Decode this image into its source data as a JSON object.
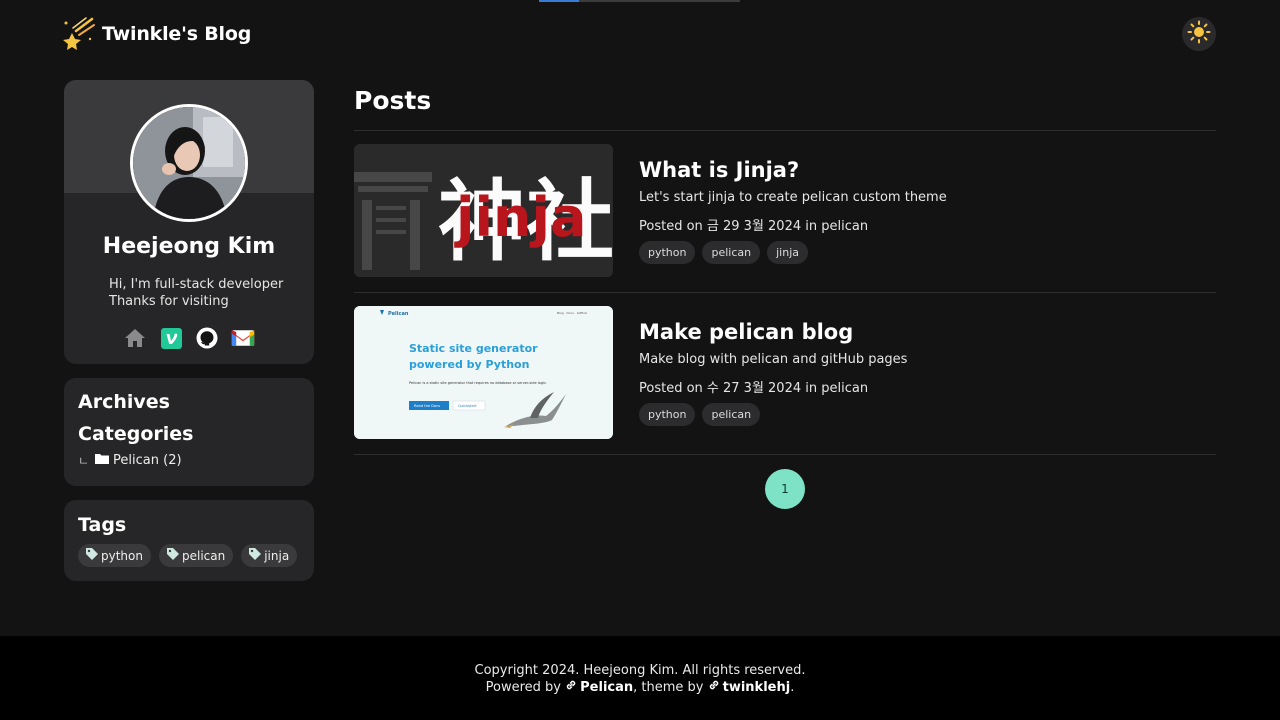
{
  "header": {
    "site_title": "Twinkle's Blog",
    "reading_progress_pct": 20
  },
  "profile": {
    "name": "Heejeong Kim",
    "bio_line1": "Hi, I'm full-stack developer",
    "bio_line2": "Thanks for visiting",
    "social_icons": [
      "home-icon",
      "velog-icon",
      "github-icon",
      "gmail-icon"
    ]
  },
  "archives": {
    "archives_title": "Archives",
    "categories_title": "Categories",
    "category": {
      "branch": "ㄴ",
      "label": "Pelican (2)"
    }
  },
  "tags": {
    "title": "Tags",
    "items": [
      "python",
      "pelican",
      "jinja"
    ]
  },
  "main": {
    "title": "Posts",
    "posts": [
      {
        "title": "What is Jinja?",
        "summary": "Let's start jinja to create pelican custom theme",
        "meta": "Posted on 금 29 3월 2024 in pelican",
        "thumb_kanji": "神社",
        "thumb_overlay": "jinja",
        "tags": [
          "python",
          "pelican",
          "jinja"
        ]
      },
      {
        "title": "Make pelican blog",
        "summary": "Make blog with pelican and gitHub pages",
        "meta": "Posted on 수 27 3월 2024 in pelican",
        "thumb_brand": "Pelican",
        "thumb_nav": "Blog · Docs · GitHub",
        "thumb_headline1": "Static site generator",
        "thumb_headline2": "powered by Python",
        "thumb_desc": "Pelican is a static site generator that requires no database or server-side logic.",
        "thumb_btn1": "Read the Docs",
        "thumb_btn2": "Quickstart",
        "tags": [
          "python",
          "pelican"
        ]
      }
    ]
  },
  "pagination": {
    "current": "1"
  },
  "footer": {
    "copyright": "Copyright 2024. Heejeong Kim. All rights reserved.",
    "powered_prefix": "Powered by",
    "powered_link": "Pelican",
    "theme_prefix": ", theme by",
    "theme_link": "twinklehj",
    "suffix": "."
  },
  "colors": {
    "accent": "#7ee3c6",
    "background": "#131314",
    "card": "#262628"
  }
}
